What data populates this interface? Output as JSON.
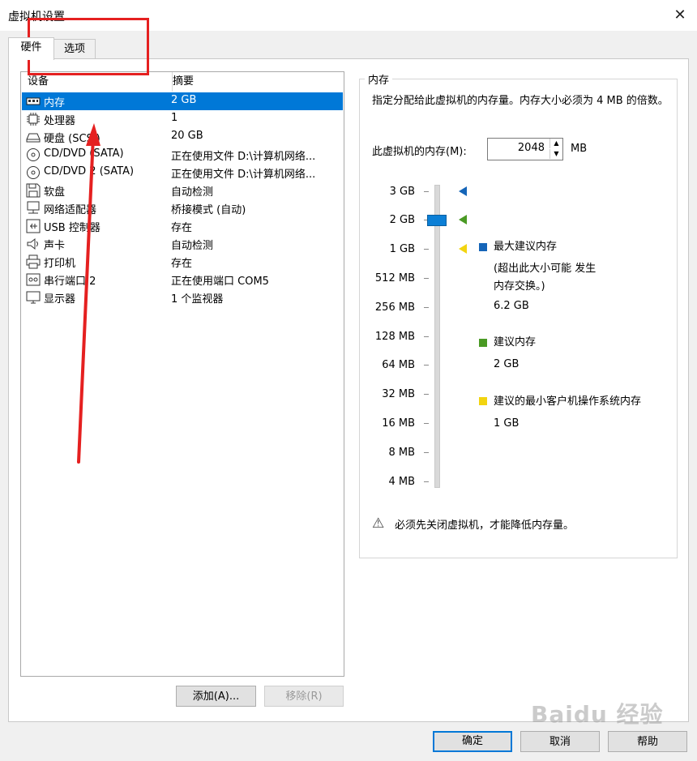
{
  "window": {
    "title": "虚拟机设置",
    "close_glyph": "✕"
  },
  "tabs": [
    {
      "label": "硬件"
    },
    {
      "label": "选项"
    }
  ],
  "device_table": {
    "headers": {
      "device": "设备",
      "summary": "摘要"
    },
    "rows": [
      {
        "name": "内存",
        "summary": "2 GB",
        "icon": "memory-icon",
        "selected": true
      },
      {
        "name": "处理器",
        "summary": "1",
        "icon": "cpu-icon"
      },
      {
        "name": "硬盘 (SCSI)",
        "summary": "20 GB",
        "icon": "harddisk-icon"
      },
      {
        "name": "CD/DVD (SATA)",
        "summary": "正在使用文件 D:\\计算机网络...",
        "icon": "cd-icon"
      },
      {
        "name": "CD/DVD 2 (SATA)",
        "summary": "正在使用文件 D:\\计算机网络...",
        "icon": "cd-icon"
      },
      {
        "name": "软盘",
        "summary": "自动检测",
        "icon": "floppy-icon"
      },
      {
        "name": "网络适配器",
        "summary": "桥接模式 (自动)",
        "icon": "network-icon"
      },
      {
        "name": "USB 控制器",
        "summary": "存在",
        "icon": "usb-icon"
      },
      {
        "name": "声卡",
        "summary": "自动检测",
        "icon": "speaker-icon"
      },
      {
        "name": "打印机",
        "summary": "存在",
        "icon": "printer-icon"
      },
      {
        "name": "串行端口 2",
        "summary": "正在使用端口 COM5",
        "icon": "serial-port-icon"
      },
      {
        "name": "显示器",
        "summary": "1 个监视器",
        "icon": "monitor-icon"
      }
    ]
  },
  "list_buttons": {
    "add": "添加(A)...",
    "remove": "移除(R)"
  },
  "memory": {
    "group_title": "内存",
    "description": "指定分配给此虚拟机的内存量。内存大小必须为 4 MB 的倍数。",
    "label": "此虚拟机的内存(M):",
    "value": "2048",
    "unit": "MB",
    "scale": [
      "3 GB",
      "2 GB",
      "1 GB",
      "512 MB",
      "256 MB",
      "128 MB",
      "64 MB",
      "32 MB",
      "16 MB",
      "8 MB",
      "4 MB"
    ],
    "legend": {
      "max_title": "最大建议内存",
      "max_note": "(超出此大小可能 发生内存交换。)",
      "max_value": "6.2 GB",
      "rec_title": "建议内存",
      "rec_value": "2 GB",
      "min_title": "建议的最小客户机操作系统内存",
      "min_value": "1 GB"
    },
    "colors": {
      "max": "#1565b8",
      "rec": "#4a9a24",
      "min": "#f2d410"
    },
    "warning": "必须先关闭虚拟机，才能降低内存量。"
  },
  "dialog_buttons": {
    "ok": "确定",
    "cancel": "取消",
    "help": "帮助"
  },
  "watermark": "Baidu 经验"
}
